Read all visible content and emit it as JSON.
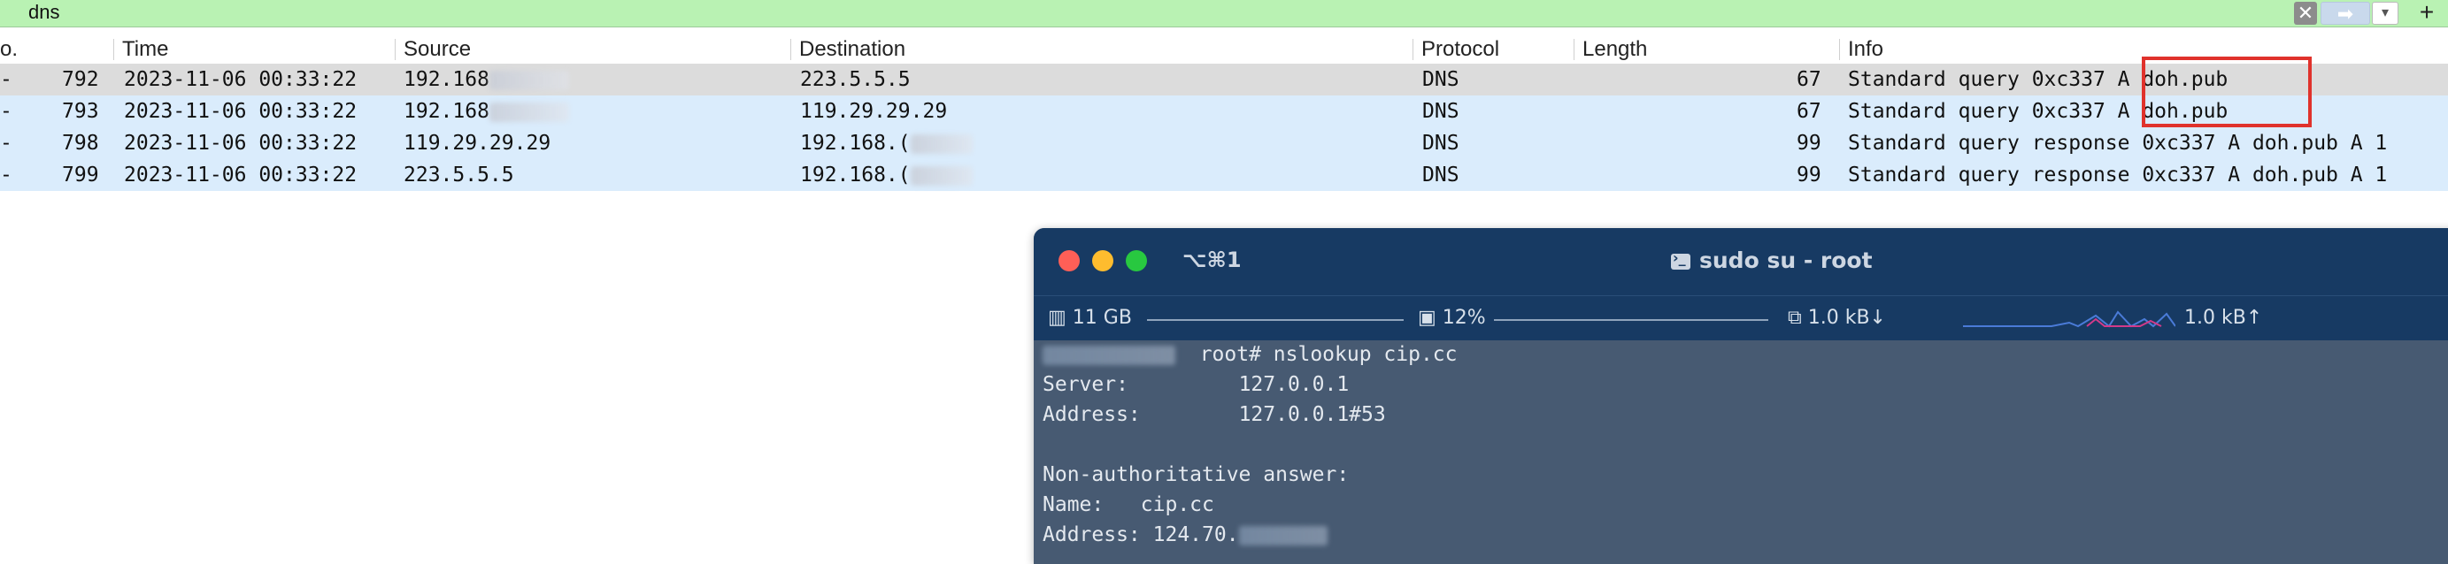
{
  "filter": {
    "value": "dns",
    "clear_icon": "close-icon",
    "apply_icon": "arrow-right-icon",
    "dropdown_icon": "chevron-down-icon",
    "add_icon": "plus-icon"
  },
  "packet_list": {
    "columns": {
      "no": "o.",
      "time": "Time",
      "source": "Source",
      "destination": "Destination",
      "protocol": "Protocol",
      "length": "Length",
      "info": "Info"
    },
    "rows": [
      {
        "no": "792",
        "time": "2023-11-06 00:33:22",
        "source": "192.168",
        "destination": "223.5.5.5",
        "protocol": "DNS",
        "length": "67",
        "info": "Standard query 0xc337 A doh.pub"
      },
      {
        "no": "793",
        "time": "2023-11-06 00:33:22",
        "source": "192.168",
        "destination": "119.29.29.29",
        "protocol": "DNS",
        "length": "67",
        "info": "Standard query 0xc337 A doh.pub"
      },
      {
        "no": "798",
        "time": "2023-11-06 00:33:22",
        "source": "119.29.29.29",
        "destination": "192.168.(",
        "protocol": "DNS",
        "length": "99",
        "info": "Standard query response 0xc337 A doh.pub A 1"
      },
      {
        "no": "799",
        "time": "2023-11-06 00:33:22",
        "source": "223.5.5.5",
        "destination": "192.168.(",
        "protocol": "DNS",
        "length": "99",
        "info": "Standard query response 0xc337 A doh.pub A 1"
      }
    ],
    "colors": {
      "selected_row": "#dcdcdc",
      "row": "#daecfc",
      "highlight_box": "#e0322c"
    }
  },
  "terminal": {
    "shortcut": "⌥⌘1",
    "title": "sudo su - root",
    "status": {
      "memory": "11 GB",
      "cpu": "12%",
      "net_down": "1.0 kB↓",
      "net_up": "1.0 kB↑"
    },
    "lines": {
      "prompt": "root# nslookup cip.cc",
      "server_label": "Server:",
      "server_value": "127.0.0.1",
      "address_label": "Address:",
      "address_value": "127.0.0.1#53",
      "answer_header": "Non-authoritative answer:",
      "name_label": "Name:",
      "name_value": "cip.cc",
      "answer_address": "Address: 124.70."
    },
    "colors": {
      "titlebar": "#173a63",
      "body": "#475a72",
      "close": "#fe5f57",
      "minimize": "#febc2e",
      "zoom": "#28c840"
    }
  }
}
